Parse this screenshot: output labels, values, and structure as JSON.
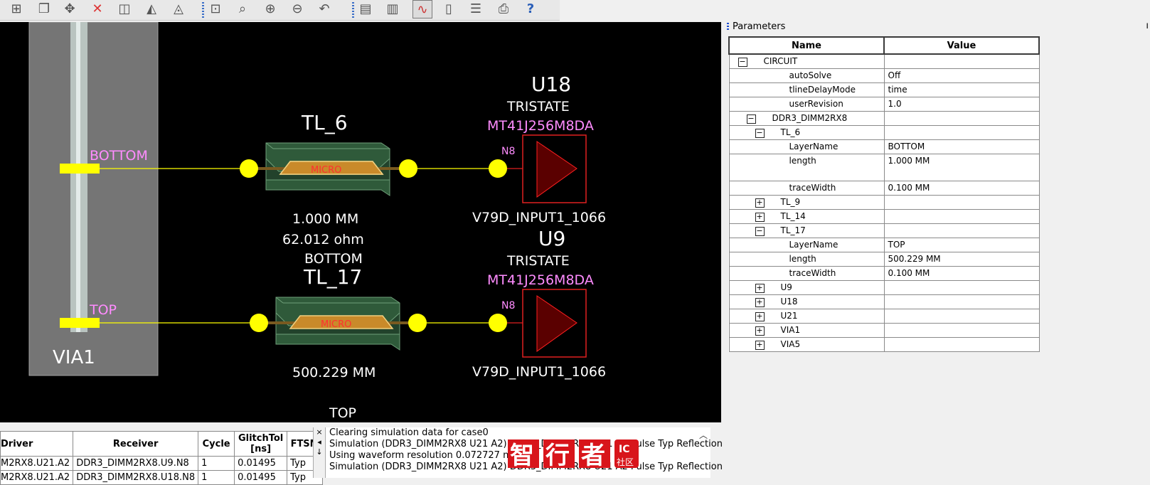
{
  "toolbar": {
    "buttons": [
      {
        "icon": "add-icon"
      },
      {
        "icon": "copy-icon"
      },
      {
        "icon": "move-icon"
      },
      {
        "icon": "delete-icon"
      },
      {
        "icon": "split-icon"
      },
      {
        "icon": "chart-icon"
      },
      {
        "icon": "measure-icon"
      },
      {
        "icon": "zoom-fit-icon"
      },
      {
        "icon": "zoom-window-icon"
      },
      {
        "icon": "zoom-in-icon"
      },
      {
        "icon": "zoom-out-icon"
      },
      {
        "icon": "zoom-previous-icon"
      },
      {
        "icon": "document-icon"
      },
      {
        "icon": "clipboard-icon"
      },
      {
        "icon": "waveform-icon"
      },
      {
        "icon": "book-icon"
      },
      {
        "icon": "layers-icon"
      },
      {
        "icon": "print-icon"
      },
      {
        "icon": "help-icon"
      }
    ]
  },
  "schematic": {
    "via": {
      "name": "VIA1",
      "top_layer": "TOP",
      "bottom_layer": "BOTTOM"
    },
    "nets": [
      {
        "tline_name": "TL_6",
        "tline_type": "MICRO",
        "length": "1.000 MM",
        "impedance": "62.012 ohm",
        "layer": "BOTTOM",
        "pin": "N8",
        "ref": "U18",
        "model_type": "TRISTATE",
        "part": "MT41J256M8DA",
        "io_model": "V79D_INPUT1_1066"
      },
      {
        "tline_name": "TL_17",
        "tline_type": "MICRO",
        "length": "500.229 MM",
        "layer": "TOP",
        "pin": "N8",
        "ref": "U9",
        "model_type": "TRISTATE",
        "part": "MT41J256M8DA",
        "io_model": "V79D_INPUT1_1066"
      }
    ],
    "colors": {
      "background": "#000000",
      "wire": "#ffff00",
      "magenta_text": "#ff8cff",
      "tline_body": "#2f5a3a",
      "buffer_fill": "#5a0000",
      "buffer_outline": "#e02020"
    }
  },
  "params": {
    "title": "Parameters",
    "headers": {
      "name": "Name",
      "value": "Value"
    },
    "rows": [
      {
        "indent": 0,
        "toggle": "minus",
        "name": "CIRCUIT",
        "value": ""
      },
      {
        "indent": 2,
        "toggle": "",
        "name": "autoSolve",
        "value": "Off"
      },
      {
        "indent": 2,
        "toggle": "",
        "name": "tlineDelayMode",
        "value": "time"
      },
      {
        "indent": 2,
        "toggle": "",
        "name": "userRevision",
        "value": "1.0"
      },
      {
        "indent": 1,
        "toggle": "minus",
        "name": "DDR3_DIMM2RX8",
        "value": ""
      },
      {
        "indent": 2,
        "toggle": "minus",
        "name": "TL_6",
        "value": ""
      },
      {
        "indent": 2,
        "toggle": "",
        "name": "LayerName",
        "value": "BOTTOM"
      },
      {
        "indent": 2,
        "toggle": "",
        "name": "length",
        "value": "1.000 MM",
        "tall": true
      },
      {
        "indent": 2,
        "toggle": "",
        "name": "traceWidth",
        "value": "0.100 MM"
      },
      {
        "indent": 2,
        "toggle": "plus",
        "name": "TL_9",
        "value": ""
      },
      {
        "indent": 2,
        "toggle": "plus",
        "name": "TL_14",
        "value": ""
      },
      {
        "indent": 2,
        "toggle": "minus",
        "name": "TL_17",
        "value": ""
      },
      {
        "indent": 2,
        "toggle": "",
        "name": "LayerName",
        "value": "TOP"
      },
      {
        "indent": 2,
        "toggle": "",
        "name": "length",
        "value": "500.229 MM"
      },
      {
        "indent": 2,
        "toggle": "",
        "name": "traceWidth",
        "value": "0.100 MM"
      },
      {
        "indent": 2,
        "toggle": "plus",
        "name": "U9",
        "value": ""
      },
      {
        "indent": 2,
        "toggle": "plus",
        "name": "U18",
        "value": ""
      },
      {
        "indent": 2,
        "toggle": "plus",
        "name": "U21",
        "value": ""
      },
      {
        "indent": 2,
        "toggle": "plus",
        "name": "VIA1",
        "value": ""
      },
      {
        "indent": 2,
        "toggle": "plus",
        "name": "VIA5",
        "value": ""
      }
    ]
  },
  "results": {
    "headers": [
      "Driver",
      "Receiver",
      "Cycle",
      "GlitchTol\n[ns]",
      "FTSM"
    ],
    "rows": [
      [
        "M2RX8.U21.A2",
        "DDR3_DIMM2RX8.U9.N8",
        "1",
        "0.01495",
        "Typ"
      ],
      [
        "M2RX8.U21.A2",
        "DDR3_DIMM2RX8.U18.N8",
        "1",
        "0.01495",
        "Typ"
      ]
    ]
  },
  "log": {
    "lines": [
      "Clearing simulation data for case0",
      "Simulation (DDR3_DIMM2RX8 U21 A2) DDR3_DIMM2RX8 U21 A2 Pulse Typ Reflection",
      "Using waveform resolution 0.072727 ns.",
      "Simulation (DDR3_DIMM2RX8 U21 A2) DDR3_DIMM2RX8 U21 A2 Pulse Typ Reflection"
    ],
    "controls": [
      "×",
      "◂",
      "↓"
    ]
  },
  "watermark": {
    "chars": [
      "智",
      "行",
      "者"
    ],
    "badge_top": "IC",
    "badge_bottom": "社区"
  }
}
